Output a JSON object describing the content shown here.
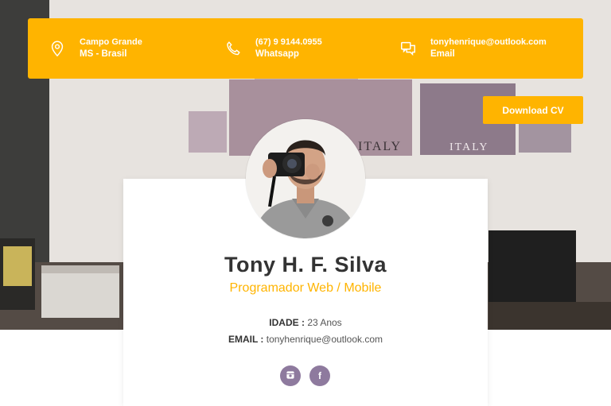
{
  "contact": {
    "location": {
      "line1": "Campo Grande",
      "line2": "MS - Brasil",
      "icon": "map-pin-icon"
    },
    "phone": {
      "line1": "(67) 9 9144.0955",
      "line2": "Whatsapp",
      "icon": "phone-icon"
    },
    "email": {
      "line1": "tonyhenrique@outlook.com",
      "line2": "Email",
      "icon": "chat-icon"
    }
  },
  "download_label": "Download CV",
  "profile": {
    "name": "Tony H. F. Silva",
    "role": "Programador Web / Mobile",
    "age_label": "IDADE :",
    "age_value": "23 Anos",
    "email_label": "EMAIL :",
    "email_value": "tonyhenrique@outlook.com"
  },
  "socials": [
    {
      "icon": "instagram-icon"
    },
    {
      "icon": "facebook-icon",
      "glyph": "f"
    }
  ],
  "background_text": [
    "ITALY",
    "ITALY"
  ],
  "colors": {
    "accent": "#ffb400",
    "social": "#8e7a9e",
    "name": "#333333"
  }
}
